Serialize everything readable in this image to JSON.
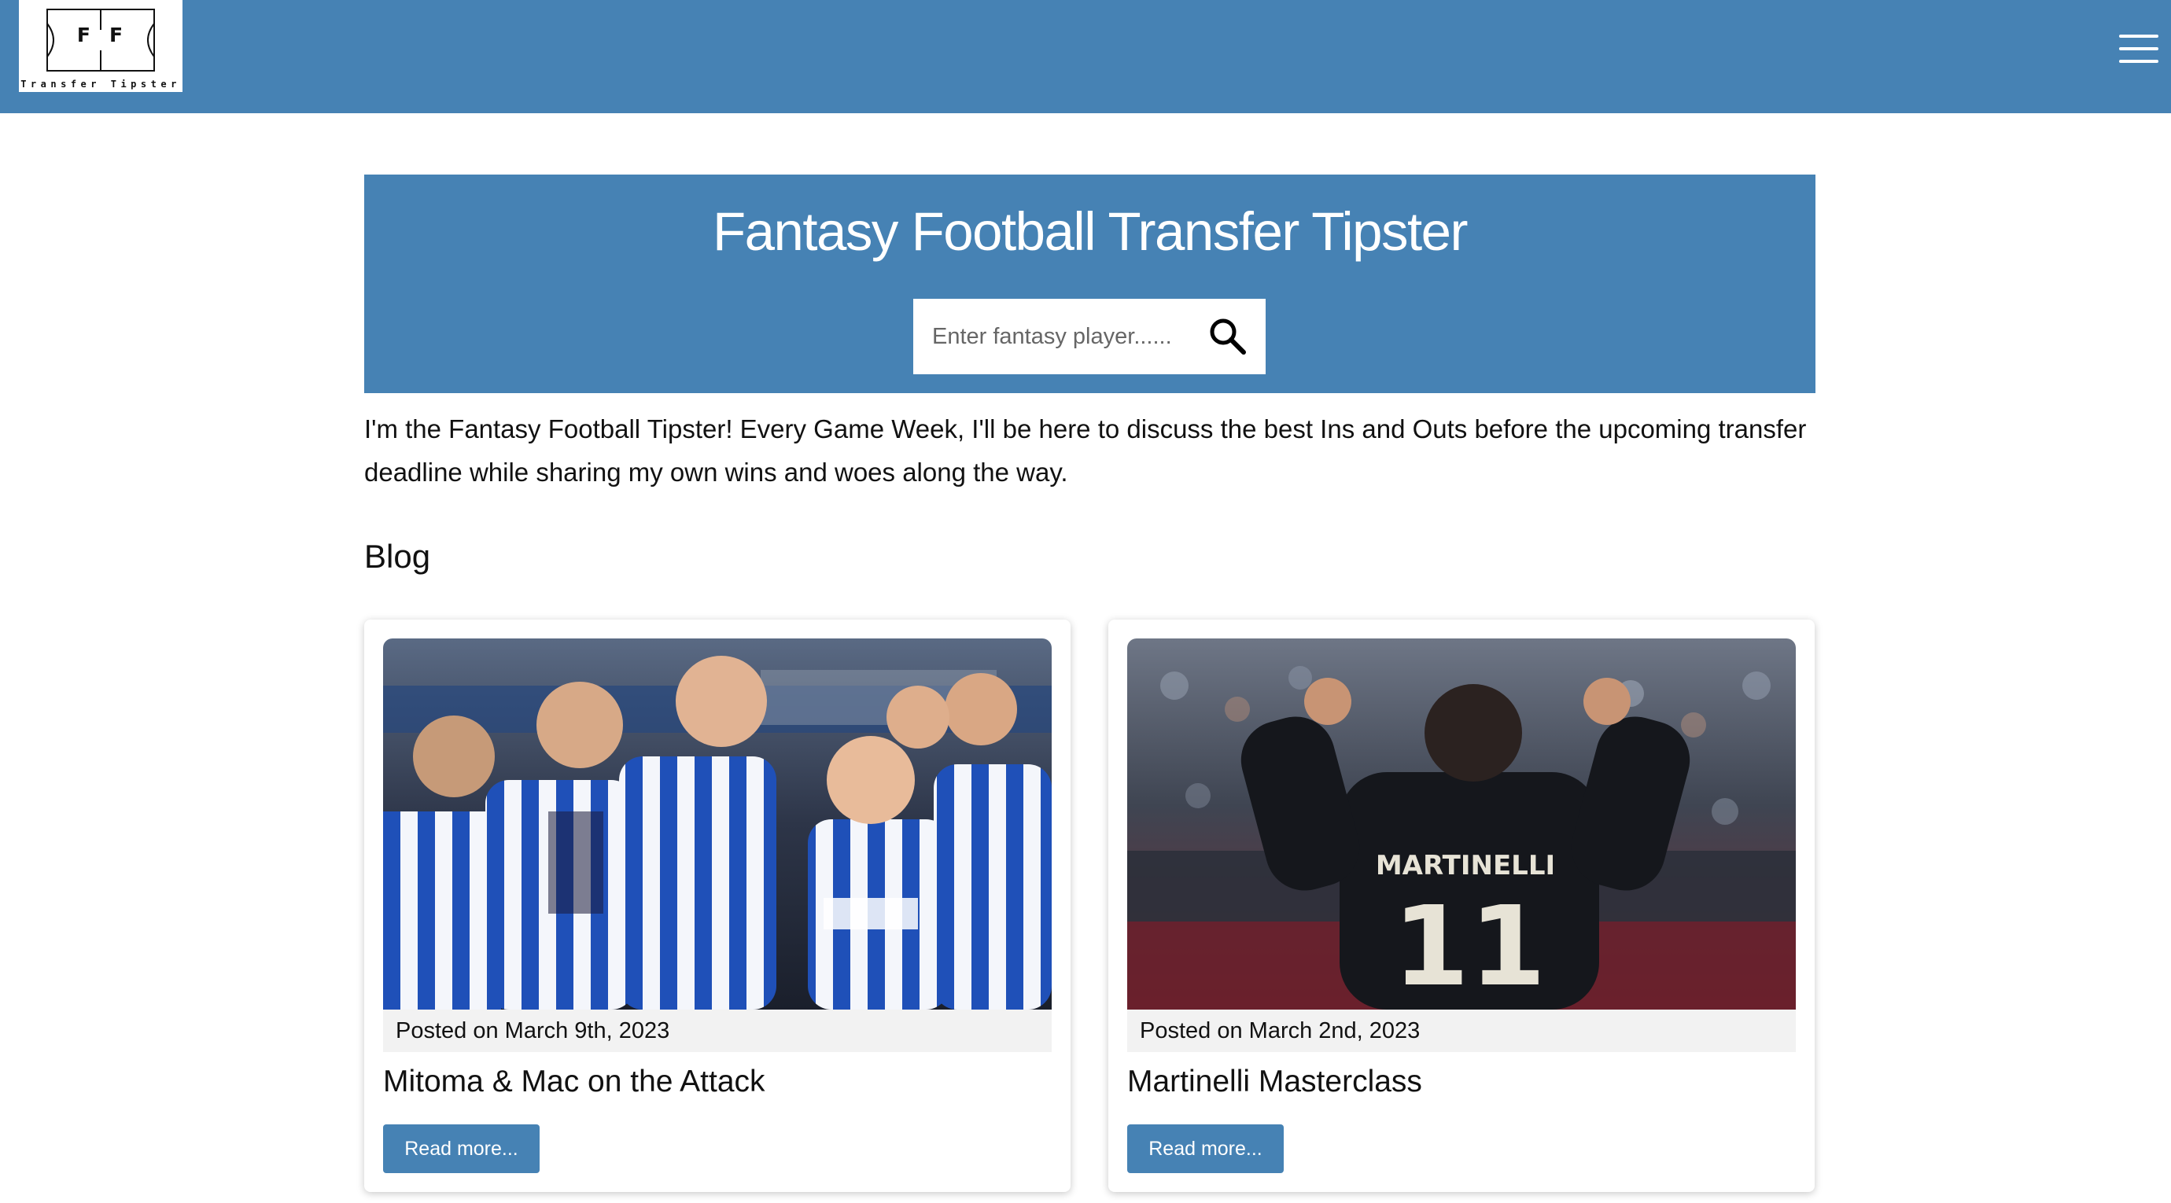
{
  "brand": {
    "logo_letters_left": "F",
    "logo_letters_right": "F",
    "logo_caption": "Transfer Tipster"
  },
  "nav": {
    "menu_icon": "hamburger-menu-icon"
  },
  "hero": {
    "title": "Fantasy Football Transfer Tipster",
    "search": {
      "placeholder": "Enter fantasy player......",
      "value": "",
      "icon": "search-icon"
    }
  },
  "intro": {
    "text": "I'm the Fantasy Football Tipster! Every Game Week, I'll be here to discuss the best Ins and Outs before the upcoming transfer deadline while sharing my own wins and woes along the way."
  },
  "blog": {
    "heading": "Blog",
    "posts": [
      {
        "image": "photo of footballers in blue-and-white striped kits celebrating",
        "posted": "Posted on March 9th, 2023",
        "title": "Mitoma & Mac on the Attack",
        "button": "Read more..."
      },
      {
        "image": "photo of a player in a dark kit with MARTINELLI 11 on the back, arms raised",
        "posted": "Posted on March 2nd, 2023",
        "title": "Martinelli Masterclass",
        "button": "Read more..."
      }
    ]
  },
  "colors": {
    "primary": "#4682b4",
    "background": "#ffffff",
    "text": "#111111",
    "posted_bg": "#f2f2f2"
  }
}
